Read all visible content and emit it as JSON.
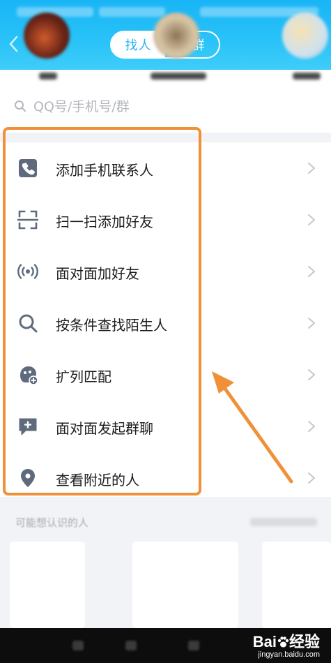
{
  "header": {
    "tabs": [
      {
        "label": "找人",
        "active": true
      },
      {
        "label": "找群",
        "active": false
      }
    ]
  },
  "search": {
    "placeholder": "QQ号/手机号/群"
  },
  "menu": {
    "items": [
      {
        "label": "添加手机联系人",
        "icon": "phone-icon"
      },
      {
        "label": "扫一扫添加好友",
        "icon": "scan-icon"
      },
      {
        "label": "面对面加好友",
        "icon": "nearby-signal-icon"
      },
      {
        "label": "按条件查找陌生人",
        "icon": "search-icon"
      },
      {
        "label": "扩列匹配",
        "icon": "match-icon"
      },
      {
        "label": "面对面发起群聊",
        "icon": "group-chat-add-icon"
      },
      {
        "label": "查看附近的人",
        "icon": "location-pin-icon"
      }
    ]
  },
  "suggestions": {
    "title": "可能想认识的人"
  },
  "watermark": {
    "brand": "Bai",
    "brand_suffix": "经验",
    "url": "jingyan.baidu.com"
  },
  "colors": {
    "header_blue": "#18b4f6",
    "highlight_orange": "#f0913a",
    "icon_gray": "#5f6b7c"
  }
}
